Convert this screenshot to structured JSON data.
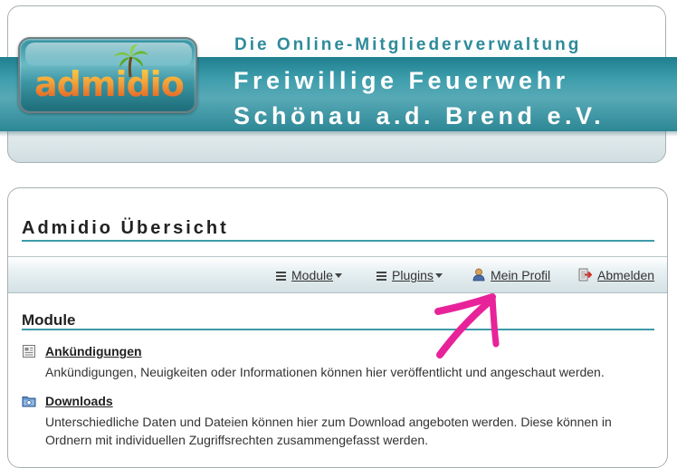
{
  "header": {
    "logo_text": "admidio",
    "subtitle": "Die Online-Mitgliederverwaltung",
    "org_line1": "Freiwillige Feuerwehr",
    "org_line2": "Schönau a.d. Brend e.V."
  },
  "page": {
    "title": "Admidio Übersicht"
  },
  "menu": {
    "items": [
      {
        "label": "Module",
        "icon": "hamburger-icon",
        "dropdown": true
      },
      {
        "label": "Plugins",
        "icon": "hamburger-icon",
        "dropdown": true
      },
      {
        "label": "Mein Profil",
        "icon": "user-profile-icon",
        "dropdown": false
      },
      {
        "label": "Abmelden",
        "icon": "logout-icon",
        "dropdown": false
      }
    ]
  },
  "modules": {
    "section_title": "Module",
    "items": [
      {
        "name": "Ankündigungen",
        "icon": "announcements-icon",
        "description": "Ankündigungen, Neuigkeiten oder Informationen können hier veröffentlicht und angeschaut werden."
      },
      {
        "name": "Downloads",
        "icon": "downloads-folder-icon",
        "description": "Unterschiedliche Daten und Dateien können hier zum Download angeboten werden. Diese können in Ordnern mit individuellen Zugriffsrechten zusammengefasst werden."
      }
    ]
  },
  "colors": {
    "accent": "#3c9aa8",
    "header_band": "#3f9eac",
    "annotation_arrow": "#e8239a"
  }
}
